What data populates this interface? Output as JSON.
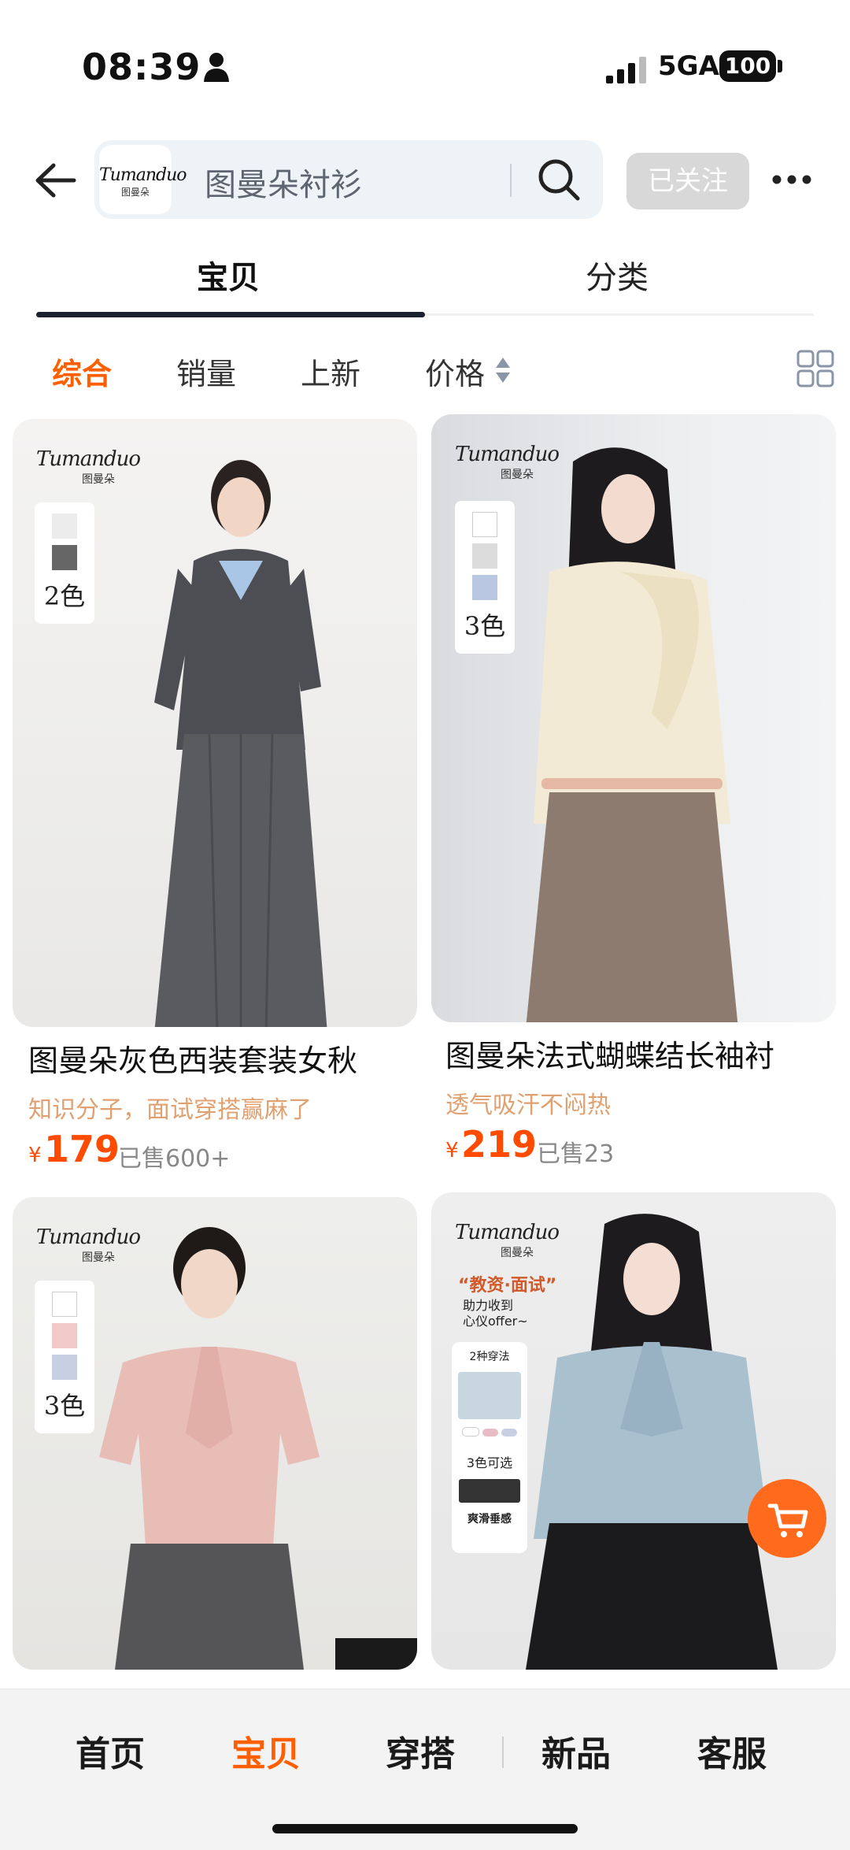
{
  "status": {
    "time": "08:39",
    "network": "5GA",
    "battery": "100"
  },
  "search": {
    "brand_logo": "Tumanduo",
    "brand_logo_cn": "图曼朵",
    "query": "图曼朵衬衫",
    "follow_label": "已关注"
  },
  "tabs": {
    "products": "宝贝",
    "category": "分类"
  },
  "sort": {
    "all": "综合",
    "sales": "销量",
    "new": "上新",
    "price": "价格"
  },
  "products": [
    {
      "title": "图曼朵灰色西装套装女秋",
      "subtitle": "知识分子，面试穿搭赢麻了",
      "currency": "¥",
      "price": "179",
      "sold": "已售600+",
      "colors": "2色",
      "swatches": [
        "#ececec",
        "#666666"
      ]
    },
    {
      "title": "图曼朵法式蝴蝶结长袖衬",
      "subtitle": "透气吸汗不闷热",
      "currency": "¥",
      "price": "219",
      "sold": "已售23",
      "colors": "3色",
      "swatches": [
        "#ffffff",
        "#dcdcdc",
        "#b9c7e2"
      ]
    },
    {
      "title": "",
      "subtitle": "",
      "colors": "3色",
      "swatches": [
        "#ffffff",
        "#f2c9c9",
        "#c8cfe3"
      ]
    },
    {
      "title": "",
      "subtitle": "",
      "promo_title": "“教资·面试”",
      "promo_text": "助力收到\n心仪offer~",
      "promo_styles": "2种穿法",
      "promo_colors": "3色可选",
      "promo_feature": "爽滑垂感"
    }
  ],
  "image_logo": {
    "en": "Tumanduo",
    "cn": "图曼朵"
  },
  "bottom_nav": {
    "home": "首页",
    "products": "宝贝",
    "outfit": "穿搭",
    "new": "新品",
    "service": "客服"
  },
  "colors": {
    "accent": "#ff5f00",
    "price": "#ff4b00"
  }
}
